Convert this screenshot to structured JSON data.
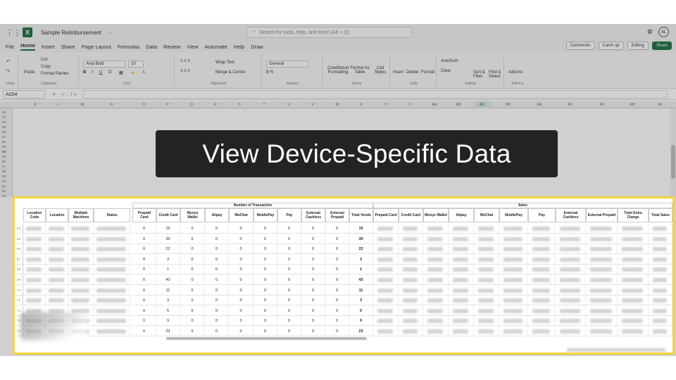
{
  "titlebar": {
    "doc_title": "Sample Reimbursement",
    "search_placeholder": "Search for tools, help, and more (Alt + Q)",
    "avatar_initials": "AL"
  },
  "menu": {
    "items": [
      "File",
      "Home",
      "Insert",
      "Share",
      "Page Layout",
      "Formulas",
      "Data",
      "Review",
      "View",
      "Automate",
      "Help",
      "Draw"
    ],
    "active": "Home",
    "comments": "Comments",
    "catch_up": "Catch up",
    "editing": "Editing",
    "share": "Share"
  },
  "ribbon": {
    "undo": "Undo",
    "paste": "Paste",
    "cut": "Cut",
    "copy": "Copy",
    "format_painter": "Format Painter",
    "clipboard": "Clipboard",
    "font_name": "Arial Bold",
    "font_size": "10",
    "font_group": "Font",
    "wrap_text": "Wrap Text",
    "merge_centre": "Merge & Centre",
    "alignment": "Alignment",
    "number_format": "General",
    "number_group": "Number",
    "conditional_formatting": "Conditional Formatting",
    "format_as_table": "Format As Table",
    "cell_styles": "Cell Styles",
    "styles_group": "Styles",
    "insert": "Insert",
    "delete": "Delete",
    "format": "Format",
    "cells_group": "Cells",
    "autosum": "AutoSum",
    "clear": "Clear",
    "sort_filter": "Sort & Filter",
    "find_select": "Find & Select",
    "editing_group": "Editing",
    "addins": "Add-ins",
    "addins_group": "Add-ins"
  },
  "formula_bar": {
    "name_box": "AC54",
    "fx": "fx"
  },
  "columns": [
    "K",
    "L",
    "M",
    "N",
    "O",
    "P",
    "Q",
    "R",
    "S",
    "T",
    "U",
    "V",
    "W",
    "X",
    "Y",
    "Z",
    "AA",
    "AB",
    "AC",
    "AD",
    "AE",
    "AF",
    "AG",
    "AH",
    "AI"
  ],
  "selected_column": "AC",
  "rows": [
    "46",
    "47",
    "48",
    "49",
    "50",
    "51",
    "52",
    "53",
    "54",
    "55",
    "56",
    "57",
    "58",
    "59",
    "60",
    "61",
    "62",
    "63"
  ],
  "selected_row": "54",
  "caption": "View Device-Specific Data",
  "table": {
    "group_transactions": "Number of Transaction",
    "group_sales": "Sales",
    "left_headers": [
      "Location Code",
      "Location",
      "Multiple Machines",
      "Status"
    ],
    "txn_headers": [
      "Prepaid Card",
      "Credit Card",
      "Monyx Wallet",
      "Alipay",
      "WeChat",
      "MobilePay",
      "Pay",
      "External Cashless",
      "External Prepaid",
      "Total Vends"
    ],
    "sales_headers": [
      "Prepaid Card",
      "Credit Card",
      "Monyx Wallet",
      "Alipay",
      "WeChat",
      "MobilePay",
      "Pay",
      "External Cashless",
      "External Prepaid",
      "Total Extra Charge",
      "Total Sales"
    ],
    "row_numbers": [
      "64",
      "65",
      "66",
      "67",
      "68",
      "69",
      "70",
      "71",
      "72",
      "73",
      "74"
    ],
    "rows": [
      [
        "0",
        "15",
        "0",
        "0",
        "0",
        "0",
        "0",
        "0",
        "0",
        "15"
      ],
      [
        "0",
        "30",
        "0",
        "0",
        "0",
        "0",
        "0",
        "0",
        "0",
        "30"
      ],
      [
        "0",
        "22",
        "0",
        "0",
        "0",
        "0",
        "0",
        "0",
        "0",
        "22"
      ],
      [
        "0",
        "3",
        "0",
        "0",
        "0",
        "0",
        "0",
        "0",
        "0",
        "3"
      ],
      [
        "0",
        "1",
        "0",
        "0",
        "0",
        "0",
        "0",
        "0",
        "0",
        "1"
      ],
      [
        "0",
        "43",
        "0",
        "0",
        "0",
        "0",
        "0",
        "0",
        "0",
        "43"
      ],
      [
        "0",
        "11",
        "0",
        "0",
        "0",
        "0",
        "0",
        "0",
        "0",
        "11"
      ],
      [
        "0",
        "3",
        "0",
        "0",
        "0",
        "0",
        "0",
        "0",
        "0",
        "3"
      ],
      [
        "0",
        "5",
        "0",
        "0",
        "0",
        "0",
        "0",
        "0",
        "0",
        "5"
      ],
      [
        "0",
        "9",
        "0",
        "0",
        "0",
        "0",
        "0",
        "0",
        "0",
        "9"
      ],
      [
        "0",
        "23",
        "0",
        "0",
        "0",
        "0",
        "0",
        "0",
        "0",
        "23"
      ]
    ]
  },
  "colors": {
    "excel_green": "#1d6f42",
    "highlight_yellow": "#f7d23b",
    "caption_bg": "#232323"
  }
}
